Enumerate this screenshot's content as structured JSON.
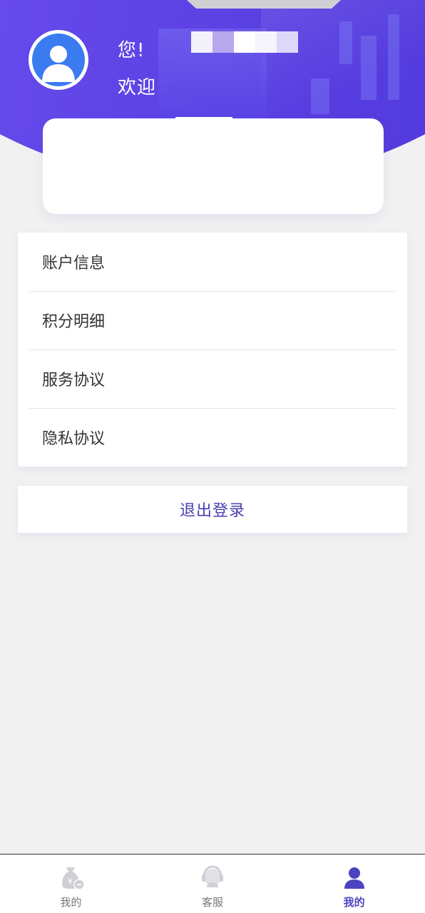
{
  "header": {
    "greeting_line1": "您!",
    "greeting_line2": "欢迎"
  },
  "menu": {
    "items": [
      {
        "label": "账户信息"
      },
      {
        "label": "积分明细"
      },
      {
        "label": "服务协议"
      },
      {
        "label": "隐私协议"
      }
    ]
  },
  "logout": {
    "label": "退出登录"
  },
  "tabbar": {
    "tabs": [
      {
        "label": "我的",
        "icon": "money-bag-icon"
      },
      {
        "label": "客服",
        "icon": "customer-service-icon"
      },
      {
        "label": "我的",
        "icon": "user-icon"
      }
    ],
    "active_index": 2
  },
  "colors": {
    "brand": "#5a3fe2",
    "accent_text": "#4a3fb0",
    "avatar_bg": "#3a7bf0"
  }
}
